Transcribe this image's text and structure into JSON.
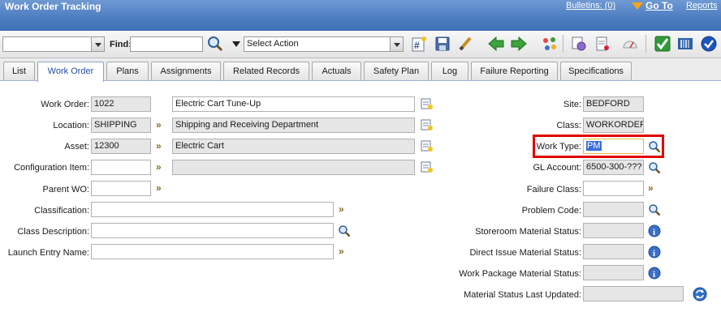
{
  "app": {
    "title": "Work Order Tracking",
    "bulletins": "Bulletins: (0)",
    "goto": "Go To",
    "reports": "Reports"
  },
  "toolbar": {
    "find_label": "Find:",
    "find_value": "",
    "query_value": "",
    "action_select": "Select Action"
  },
  "tabs": [
    "List",
    "Work Order",
    "Plans",
    "Assignments",
    "Related Records",
    "Actuals",
    "Safety Plan",
    "Log",
    "Failure Reporting",
    "Specifications"
  ],
  "active_tab": "Work Order",
  "left": {
    "work_order": {
      "label": "Work Order:",
      "value": "1022",
      "description": "Electric Cart Tune-Up"
    },
    "location": {
      "label": "Location:",
      "value": "SHIPPING",
      "description": "Shipping and Receiving Department"
    },
    "asset": {
      "label": "Asset:",
      "value": "12300",
      "description": "Electric Cart"
    },
    "config_item": {
      "label": "Configuration Item:",
      "value": "",
      "description": ""
    },
    "parent_wo": {
      "label": "Parent WO:",
      "value": ""
    },
    "classification": {
      "label": "Classification:",
      "value": ""
    },
    "class_description": {
      "label": "Class Description:",
      "value": ""
    },
    "launch_entry": {
      "label": "Launch Entry Name:",
      "value": ""
    }
  },
  "right": {
    "site": {
      "label": "Site:",
      "value": "BEDFORD"
    },
    "class": {
      "label": "Class:",
      "value": "WORKORDER"
    },
    "work_type": {
      "label": "Work Type:",
      "value": "PM"
    },
    "gl_account": {
      "label": "GL Account:",
      "value": "6500-300-???"
    },
    "failure_class": {
      "label": "Failure Class:",
      "value": ""
    },
    "problem_code": {
      "label": "Problem Code:",
      "value": ""
    },
    "storeroom_status": {
      "label": "Storeroom Material Status:",
      "value": ""
    },
    "direct_issue_status": {
      "label": "Direct Issue Material Status:",
      "value": ""
    },
    "work_package_status": {
      "label": "Work Package Material Status:",
      "value": ""
    },
    "material_last_updated": {
      "label": "Material Status Last Updated:",
      "value": ""
    }
  },
  "colors": {
    "title_bar": "#4c7cc0",
    "highlight": "#e00000",
    "tab_active_text": "#1f4fa3"
  },
  "icons": [
    "magnifier-icon",
    "new-record-icon",
    "save-icon",
    "clear-icon",
    "previous-arrow-icon",
    "next-arrow-icon",
    "workflow-icon",
    "duplicate-icon",
    "report-icon",
    "gauge-icon",
    "approve-icon",
    "barcode-icon",
    "route-icon",
    "detail-menu-icon",
    "lookup-icon",
    "info-icon",
    "refresh-icon",
    "long-description-icon"
  ]
}
